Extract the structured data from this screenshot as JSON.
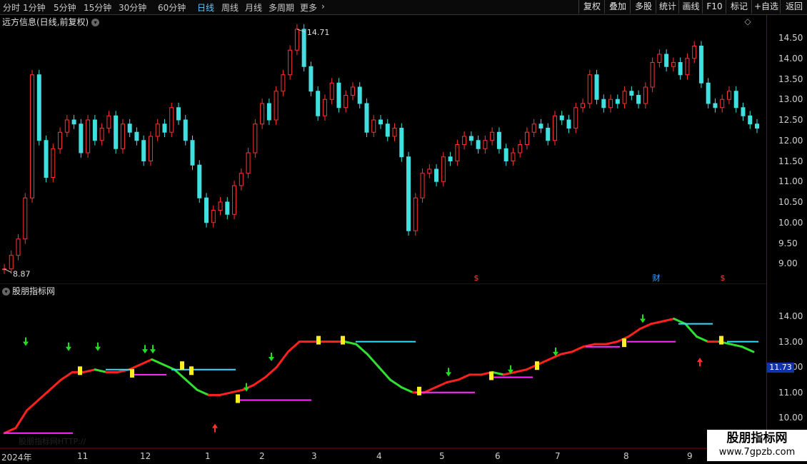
{
  "toolbar": {
    "period_tabs": [
      "分时",
      "1分钟",
      "5分钟",
      "15分钟",
      "30分钟",
      "60分钟",
      "日线",
      "周线",
      "月线",
      "多周期",
      "更多"
    ],
    "active_tab": "日线",
    "more_arrow": "›",
    "right_buttons": [
      "复权",
      "叠加",
      "多股",
      "统计",
      "画线",
      "F10",
      "标记",
      "+自选",
      "返回"
    ]
  },
  "main_chart": {
    "title": "远方信息(日线,前复权)",
    "y_ticks": [
      "14.50",
      "14.00",
      "13.50",
      "13.00",
      "12.50",
      "12.00",
      "11.50",
      "11.00",
      "10.50",
      "10.00",
      "9.50",
      "9.00"
    ],
    "high_label": "14.71",
    "low_label": "8.87",
    "event_markers": [
      "$",
      "财",
      "$"
    ],
    "diamond_icon": "◇"
  },
  "indicator_chart": {
    "title": "股朋指标网",
    "y_ticks": [
      "14.00",
      "13.00",
      "12.00",
      "11.00",
      "10.00"
    ],
    "current_value": "11.73",
    "faded_text": "股朋指标网HTTP://"
  },
  "x_axis": {
    "labels": [
      "2024年",
      "11",
      "12",
      "1",
      "2",
      "3",
      "4",
      "5",
      "6",
      "7",
      "8",
      "9"
    ]
  },
  "watermark": {
    "line1": "股朋指标网",
    "line2": "www.7gpzb.com"
  },
  "colors": {
    "up": "#ff3333",
    "down": "#40e0e0",
    "line_up": "#ff2020",
    "line_down": "#30e030",
    "support_line": "#ff30ff",
    "resist_line": "#30e0ff",
    "axis_border": "#8b0000"
  },
  "chart_data": [
    {
      "type": "candlestick",
      "title": "远方信息(日线,前复权)",
      "x": [
        "2024年",
        "11",
        "12",
        "1",
        "2",
        "3",
        "4",
        "5",
        "6",
        "7",
        "8",
        "9"
      ],
      "close": [
        8.87,
        9.2,
        9.6,
        10.6,
        13.6,
        12.0,
        11.1,
        11.8,
        12.2,
        12.5,
        12.4,
        11.7,
        12.5,
        12.0,
        12.3,
        12.6,
        11.8,
        12.4,
        12.2,
        12.0,
        11.5,
        12.1,
        12.4,
        12.2,
        12.8,
        12.5,
        12.0,
        11.4,
        10.6,
        10.0,
        10.3,
        10.5,
        10.2,
        10.9,
        11.2,
        11.7,
        12.4,
        12.9,
        12.5,
        13.2,
        13.6,
        14.2,
        14.71,
        13.8,
        13.2,
        12.6,
        13.0,
        13.4,
        12.8,
        13.1,
        13.3,
        12.9,
        12.2,
        12.5,
        12.4,
        12.1,
        12.3,
        11.6,
        9.8,
        10.6,
        11.2,
        11.3,
        11.0,
        11.6,
        11.5,
        11.9,
        12.1,
        12.0,
        11.8,
        12.0,
        12.2,
        11.8,
        11.5,
        11.7,
        11.9,
        12.2,
        12.4,
        12.3,
        12.0,
        12.6,
        12.5,
        12.3,
        12.8,
        12.9,
        13.6,
        13.0,
        12.8,
        13.0,
        12.9,
        13.2,
        13.1,
        12.9,
        13.3,
        13.9,
        14.1,
        13.8,
        13.9,
        13.6,
        14.0,
        14.3,
        13.4,
        12.9,
        12.8,
        13.0,
        13.2,
        12.8,
        12.6,
        12.4,
        12.3
      ]
    },
    {
      "type": "line",
      "title": "股朋指标网",
      "x": [
        "2024年",
        "11",
        "12",
        "1",
        "2",
        "3",
        "4",
        "5",
        "6",
        "7",
        "8",
        "9"
      ],
      "series": [
        {
          "values": [
            9.4,
            9.6,
            10.3,
            10.7,
            11.1,
            11.5,
            11.8,
            11.8,
            11.9,
            11.8,
            11.8,
            11.9,
            12.1,
            12.3,
            12.1,
            11.9,
            11.5,
            11.1,
            10.9,
            10.9,
            11.0,
            11.1,
            11.3,
            11.6,
            12.0,
            12.6,
            13.0,
            13.0,
            13.0,
            13.0,
            13.0,
            12.9,
            12.5,
            12.0,
            11.5,
            11.2,
            11.0,
            11.0,
            11.2,
            11.4,
            11.5,
            11.7,
            11.7,
            11.8,
            11.7,
            11.8,
            11.9,
            12.1,
            12.3,
            12.5,
            12.6,
            12.8,
            12.9,
            12.9,
            13.0,
            13.2,
            13.5,
            13.7,
            13.8,
            13.9,
            13.7,
            13.2,
            13.0,
            13.0,
            12.9,
            12.8,
            12.6
          ]
        }
      ],
      "ylim": [
        9.5,
        14.5
      ]
    }
  ]
}
